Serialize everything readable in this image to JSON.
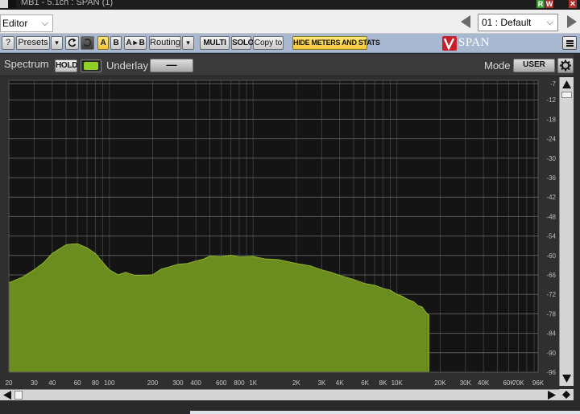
{
  "window": {
    "title": "MB1 - 5.1ch : SPAN (1)",
    "btn_r": "R",
    "btn_w": "W",
    "btn_close": "×"
  },
  "editor_row": {
    "editor_value": "Editor",
    "preset_value": "01 : Default"
  },
  "toolbar": {
    "help": "?",
    "presets": "Presets",
    "presets_arrow": "▾",
    "a": "A",
    "b": "B",
    "ab": "A ▸ B",
    "routing": "Routing",
    "routing_arrow": "▾",
    "multi": "MULTI",
    "solo": "SOLO",
    "copy_to": "Copy to",
    "hide_meters": "HIDE METERS AND STATS",
    "logo_text": "SPAN"
  },
  "spectrum_header": {
    "spectrum_label": "Spectrum",
    "hold": "HOLD",
    "underlay_label": "Underlay",
    "underlay_value": "—",
    "mode_label": "Mode",
    "mode_value": "USER"
  },
  "colors": {
    "fill": "#6b8c1f",
    "fill_top": "#8fb22c",
    "plot_bg": "#141414",
    "grid": "#3b3b3b",
    "grid_major": "#5a5a5a"
  },
  "chart_data": {
    "type": "area",
    "x_scale": "log",
    "xlim": [
      20,
      96000
    ],
    "ylim": [
      -96,
      -6
    ],
    "x_ticks": [
      {
        "label": "20",
        "v": 20
      },
      {
        "label": "30",
        "v": 30
      },
      {
        "label": "40",
        "v": 40
      },
      {
        "label": "60",
        "v": 60
      },
      {
        "label": "80",
        "v": 80
      },
      {
        "label": "100",
        "v": 100
      },
      {
        "label": "200",
        "v": 200
      },
      {
        "label": "300",
        "v": 300
      },
      {
        "label": "400",
        "v": 400
      },
      {
        "label": "600",
        "v": 600
      },
      {
        "label": "800",
        "v": 800
      },
      {
        "label": "1K",
        "v": 1000
      },
      {
        "label": "2K",
        "v": 2000
      },
      {
        "label": "3K",
        "v": 3000
      },
      {
        "label": "4K",
        "v": 4000
      },
      {
        "label": "6K",
        "v": 6000
      },
      {
        "label": "8K",
        "v": 8000
      },
      {
        "label": "10K",
        "v": 10000
      },
      {
        "label": "20K",
        "v": 20000
      },
      {
        "label": "30K",
        "v": 30000
      },
      {
        "label": "40K",
        "v": 40000
      },
      {
        "label": "60K",
        "v": 60000
      },
      {
        "label": "70K",
        "v": 70000
      },
      {
        "label": "96K",
        "v": 96000
      }
    ],
    "y_ticks": [
      -7,
      -12,
      -18,
      -24,
      -30,
      -36,
      -42,
      -48,
      -54,
      -60,
      -66,
      -72,
      -78,
      -84,
      -90,
      -96
    ],
    "grid": true,
    "spectrum": [
      {
        "f": 20,
        "db": -68.5
      },
      {
        "f": 25,
        "db": -66.5
      },
      {
        "f": 30,
        "db": -64.5
      },
      {
        "f": 35,
        "db": -62.0
      },
      {
        "f": 40,
        "db": -59.5
      },
      {
        "f": 45,
        "db": -57.8
      },
      {
        "f": 50,
        "db": -56.8
      },
      {
        "f": 55,
        "db": -56.3
      },
      {
        "f": 60,
        "db": -56.5
      },
      {
        "f": 70,
        "db": -57.5
      },
      {
        "f": 80,
        "db": -59.5
      },
      {
        "f": 90,
        "db": -62.0
      },
      {
        "f": 100,
        "db": -64.5
      },
      {
        "f": 115,
        "db": -65.8
      },
      {
        "f": 130,
        "db": -65.3
      },
      {
        "f": 150,
        "db": -66.0
      },
      {
        "f": 180,
        "db": -66.2
      },
      {
        "f": 200,
        "db": -65.8
      },
      {
        "f": 230,
        "db": -64.3
      },
      {
        "f": 260,
        "db": -63.4
      },
      {
        "f": 300,
        "db": -62.8
      },
      {
        "f": 350,
        "db": -62.3
      },
      {
        "f": 400,
        "db": -61.8
      },
      {
        "f": 450,
        "db": -61.0
      },
      {
        "f": 500,
        "db": -60.3
      },
      {
        "f": 600,
        "db": -60.2
      },
      {
        "f": 700,
        "db": -60.0
      },
      {
        "f": 800,
        "db": -60.3
      },
      {
        "f": 1000,
        "db": -60.4
      },
      {
        "f": 1200,
        "db": -60.9
      },
      {
        "f": 1500,
        "db": -61.4
      },
      {
        "f": 2000,
        "db": -62.3
      },
      {
        "f": 2500,
        "db": -63.3
      },
      {
        "f": 3000,
        "db": -64.3
      },
      {
        "f": 3500,
        "db": -65.3
      },
      {
        "f": 4000,
        "db": -66.0
      },
      {
        "f": 5000,
        "db": -67.5
      },
      {
        "f": 6000,
        "db": -68.5
      },
      {
        "f": 7000,
        "db": -69.3
      },
      {
        "f": 8000,
        "db": -70.0
      },
      {
        "f": 9000,
        "db": -70.8
      },
      {
        "f": 10000,
        "db": -71.8
      },
      {
        "f": 11000,
        "db": -72.8
      },
      {
        "f": 12000,
        "db": -73.5
      },
      {
        "f": 13000,
        "db": -74.3
      },
      {
        "f": 14000,
        "db": -75.3
      },
      {
        "f": 15000,
        "db": -76.0
      },
      {
        "f": 16000,
        "db": -77.5
      },
      {
        "f": 16700,
        "db": -78.5
      }
    ]
  }
}
